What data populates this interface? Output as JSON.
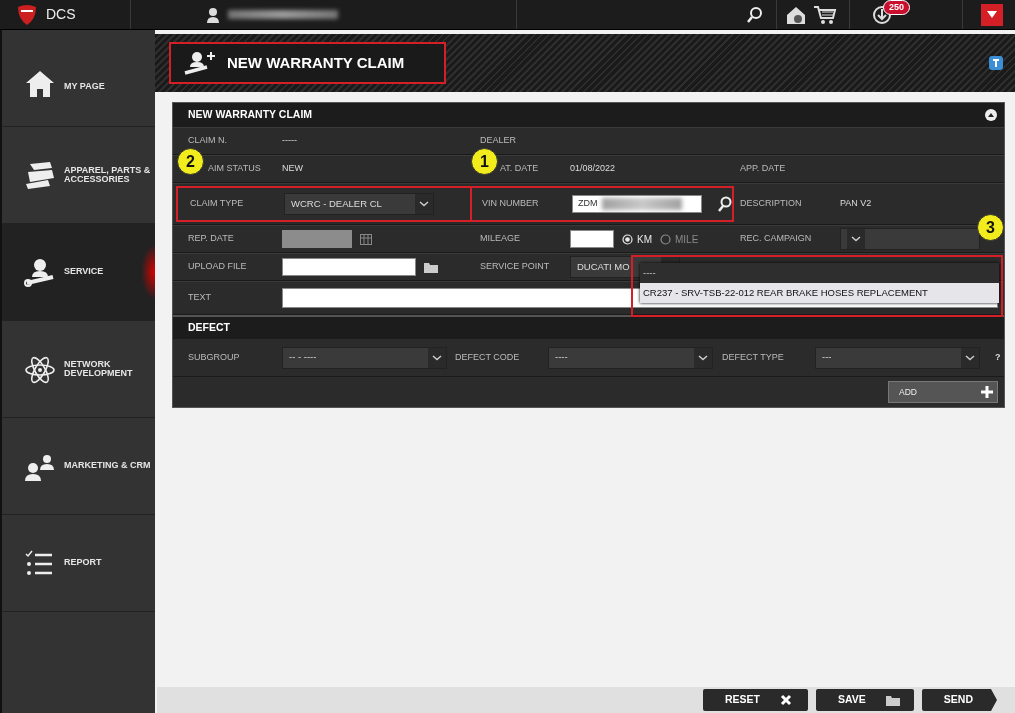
{
  "topbar": {
    "brand": "DCS",
    "notification_count": "250"
  },
  "sidebar": {
    "items": [
      {
        "label": "MY PAGE",
        "selected": false
      },
      {
        "label": "APPAREL, PARTS & ACCESSORIES",
        "selected": false
      },
      {
        "label": "SERVICE",
        "selected": true
      },
      {
        "label": "NETWORK DEVELOPMENT",
        "selected": false
      },
      {
        "label": "MARKETING & CRM",
        "selected": false
      },
      {
        "label": "REPORT",
        "selected": false
      }
    ]
  },
  "page_title": {
    "text": "NEW WARRANTY CLAIM",
    "highlighted": true
  },
  "form": {
    "title": "NEW WARRANTY CLAIM",
    "rows": [
      {
        "fields": [
          {
            "label": "CLAIM N.",
            "kind": "text",
            "value": "-----"
          },
          {
            "label": "DEALER",
            "kind": "text"
          }
        ]
      },
      {
        "fields": [
          {
            "label": "AIM STATUS",
            "kind": "text",
            "value": "NEW"
          },
          {
            "label": "AT. DATE",
            "kind": "text",
            "value": "01/08/2022"
          },
          {
            "label": "APP. DATE",
            "kind": "text"
          }
        ]
      },
      {
        "fields": [
          {
            "label": "CLAIM TYPE",
            "kind": "select",
            "value": "WCRC - DEALER CL",
            "highlighted": true,
            "callout": "2"
          },
          {
            "label": "VIN NUMBER",
            "kind": "search",
            "value": "ZDM",
            "highlighted": true,
            "callout": "1"
          },
          {
            "label": "DESCRIPTION",
            "kind": "text",
            "value": "PAN V2"
          }
        ]
      },
      {
        "fields": [
          {
            "label": "REP. DATE",
            "kind": "date"
          },
          {
            "label": "MILEAGE",
            "kind": "mileage",
            "options": [
              {
                "label": "KM",
                "selected": true,
                "disabled": false
              },
              {
                "label": "MILE",
                "selected": false,
                "disabled": true
              }
            ]
          },
          {
            "label": "REC. CAMPAIGN",
            "kind": "select",
            "callout": "3",
            "open": true
          }
        ]
      },
      {
        "fields": [
          {
            "label": "UPLOAD FILE",
            "kind": "file"
          },
          {
            "label": "SERVICE POINT",
            "kind": "select",
            "value": "DUCATI MO"
          }
        ]
      },
      {
        "fields": [
          {
            "label": "TEXT",
            "kind": "textarea"
          }
        ]
      }
    ],
    "campaign_dropdown": {
      "highlighted": true,
      "options": [
        {
          "label": "----",
          "selected": false
        },
        {
          "label": "CR237 - SRV-TSB-22-012 REAR BRAKE HOSES REPLACEMENT",
          "selected": true
        }
      ]
    }
  },
  "defect": {
    "title": "DEFECT",
    "fields": [
      {
        "label": "SUBGROUP",
        "value": "-- - ----"
      },
      {
        "label": "DEFECT CODE",
        "value": "----"
      },
      {
        "label": "DEFECT TYPE",
        "value": "---"
      }
    ],
    "help": "?",
    "add_button": "ADD"
  },
  "footer_buttons": [
    {
      "label": "RESET",
      "kind": "reset"
    },
    {
      "label": "SAVE",
      "kind": "save"
    },
    {
      "label": "SEND",
      "kind": "send"
    }
  ]
}
